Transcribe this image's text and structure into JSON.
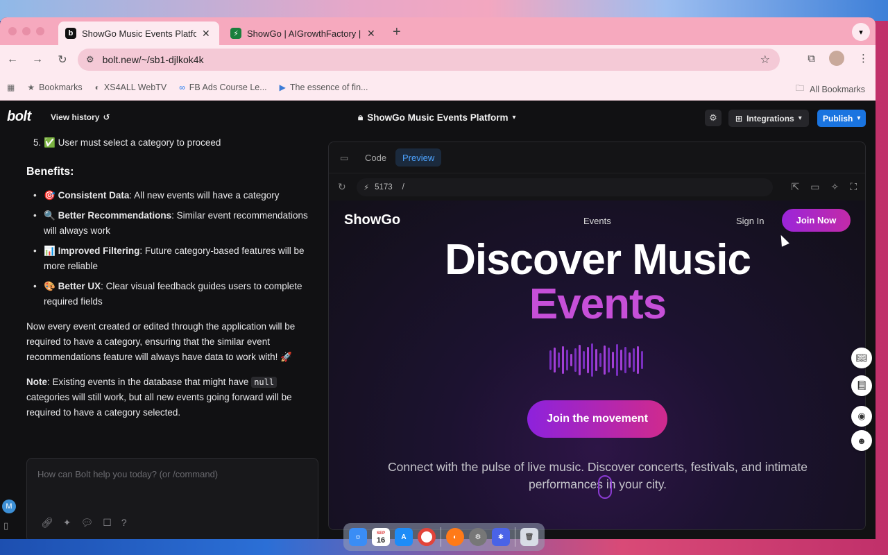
{
  "browser": {
    "tabs": [
      {
        "title": "ShowGo Music Events Platform",
        "favicon": "b",
        "favicon_color": "#111111",
        "active": true
      },
      {
        "title": "ShowGo | AIGrowthFactory | S",
        "favicon": "⚡",
        "favicon_color": "#1a7f3c",
        "active": false
      }
    ],
    "url": "bolt.new/~/sb1-djlkok4k",
    "bookmarks": [
      {
        "label": "Bookmarks",
        "icon": "star-icon"
      },
      {
        "label": "XS4ALL WebTV",
        "icon": "xs4all-icon"
      },
      {
        "label": "FB Ads Course Le...",
        "icon": "meta-icon"
      },
      {
        "label": "The essence of fin...",
        "icon": "video-icon"
      }
    ],
    "all_bookmarks": "All Bookmarks"
  },
  "app": {
    "logo": "bolt",
    "view_history": "View history",
    "project_title": "ShowGo Music Events Platform",
    "integrations": "Integrations",
    "publish": "Publish"
  },
  "chat": {
    "step": "5. ✅ User must select a category to proceed",
    "benefits_heading": "Benefits:",
    "benefits": [
      {
        "emoji": "🎯",
        "title": "Consistent Data",
        "text": ": All new events will have a category"
      },
      {
        "emoji": "🔍",
        "title": "Better Recommendations",
        "text": ": Similar event recommendations will always work"
      },
      {
        "emoji": "📊",
        "title": "Improved Filtering",
        "text": ": Future category-based features will be more reliable"
      },
      {
        "emoji": "🎨",
        "title": "Better UX",
        "text": ": Clear visual feedback guides users to complete required fields"
      }
    ],
    "summary": "Now every event created or edited through the application will be required to have a category, ensuring that the similar event recommendations feature will always have data to work with! 🚀",
    "note_label": "Note",
    "note_pre": ": Existing events in the database that might have ",
    "note_code": "null",
    "note_post": " categories will still work, but all new events going forward will be required to have a category selected.",
    "input_placeholder": "How can Bolt help you today? (or /command)",
    "avatar_initial": "M"
  },
  "preview": {
    "tab_code": "Code",
    "tab_preview": "Preview",
    "port": "5173",
    "path": "/"
  },
  "site": {
    "logo": "ShowGo",
    "nav_events": "Events",
    "nav_signin": "Sign In",
    "nav_join": "Join Now",
    "hero_line1": "Discover Music",
    "hero_line2": "Events",
    "cta": "Join the movement",
    "tagline": "Connect with the pulse of live music. Discover concerts, festivals, and intimate performances in your city."
  },
  "dock": {
    "calendar_month": "SEP",
    "calendar_day": "16"
  },
  "colors": {
    "accent": "#1a74e0",
    "brand_purple": "#9b25d9",
    "brand_pink": "#c22aa8"
  }
}
